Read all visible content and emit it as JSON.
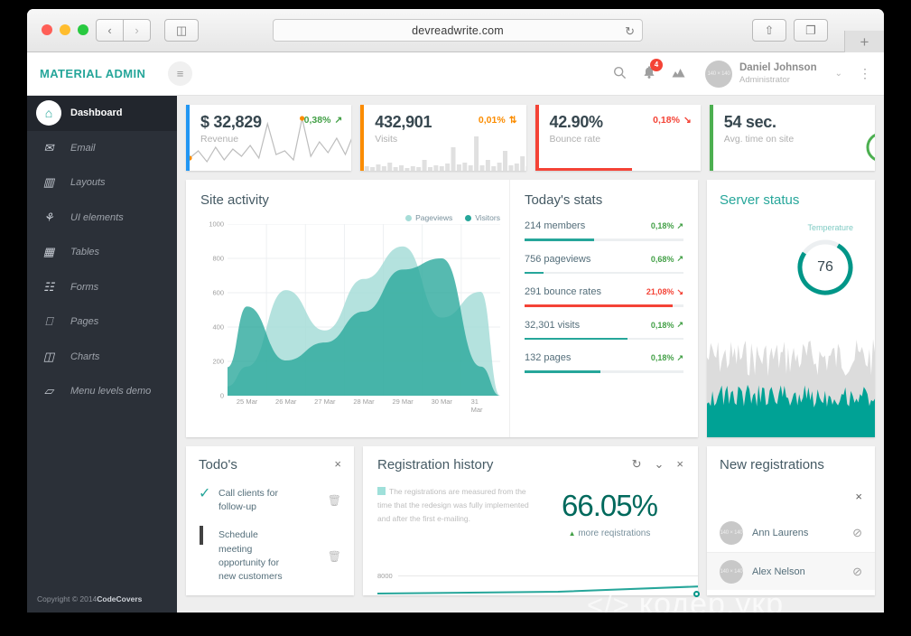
{
  "browser": {
    "url": "devreadwrite.com",
    "back_icon": "‹",
    "forward_icon": "›",
    "sidebar_icon": "◫",
    "reload_icon": "↻",
    "share_icon": "⇧",
    "tabs_icon": "❐",
    "new_tab_icon": "+"
  },
  "header": {
    "brand": "MATERIAL ADMIN",
    "hamburger_icon": "≡",
    "search_icon": "⚲",
    "bell_icon": " ὑ4",
    "notification_count": "4",
    "chart_icon": "◢",
    "avatar_text": "140 × 140",
    "user_name": "Daniel Johnson",
    "user_role": "Administrator",
    "caret_icon": "⌄",
    "more_icon": "⋮"
  },
  "sidebar": {
    "items": [
      {
        "label": "Dashboard",
        "icon": "⌂",
        "active": true
      },
      {
        "label": "Email",
        "icon": "✉",
        "active": false
      },
      {
        "label": "Layouts",
        "icon": "▥",
        "active": false
      },
      {
        "label": "UI elements",
        "icon": "⚘",
        "active": false
      },
      {
        "label": "Tables",
        "icon": "▦",
        "active": false
      },
      {
        "label": "Forms",
        "icon": "☷",
        "active": false
      },
      {
        "label": "Pages",
        "icon": "⎕",
        "active": false
      },
      {
        "label": "Charts",
        "icon": "◫",
        "active": false
      },
      {
        "label": "Menu levels demo",
        "icon": "▱",
        "active": false
      }
    ],
    "copyright_prefix": "Copyright © 2014 ",
    "copyright_brand": "CodeCovers"
  },
  "stat_cards": [
    {
      "value": "$ 32,829",
      "label": "Revenue",
      "delta": "0,38%",
      "delta_icon": "↗",
      "delta_color": "#43a047",
      "accent": "#2196f3",
      "spark": "line"
    },
    {
      "value": "432,901",
      "label": "Visits",
      "delta": "0,01%",
      "delta_icon": "⇅",
      "delta_color": "#fb8c00",
      "accent": "#fb8c00",
      "spark": "bars"
    },
    {
      "value": "42.90%",
      "label": "Bounce rate",
      "delta": "0,18%",
      "delta_icon": "↘",
      "delta_color": "#f44336",
      "accent": "#f44336",
      "spark": "none",
      "bar_percent": 58
    },
    {
      "value": "54 sec.",
      "label": "Avg. time on site",
      "delta": "",
      "delta_icon": "",
      "delta_color": "#43a047",
      "accent": "#4caf50",
      "spark": "timer"
    }
  ],
  "site_activity": {
    "title": "Site activity",
    "legend": [
      {
        "label": "Pageviews",
        "color": "#a7ddd8"
      },
      {
        "label": "Visitors",
        "color": "#26a69a"
      }
    ]
  },
  "chart_data": {
    "type": "area",
    "title": "Site activity",
    "xlabel": "",
    "ylabel": "",
    "ylim": [
      0,
      1000
    ],
    "yticks": [
      0,
      200,
      400,
      600,
      800,
      1000
    ],
    "categories": [
      "25 Mar",
      "26 Mar",
      "27 Mar",
      "28 Mar",
      "29 Mar",
      "30 Mar",
      "31 Mar"
    ],
    "grid": true,
    "legend_position": "top-right",
    "series": [
      {
        "name": "Pageviews",
        "color": "#a7ddd8",
        "values": [
          170,
          615,
          380,
          680,
          870,
          455,
          605
        ]
      },
      {
        "name": "Visitors",
        "color": "#26a69a",
        "values": [
          520,
          205,
          310,
          490,
          735,
          800,
          170
        ]
      }
    ]
  },
  "todays_stats": {
    "title": "Today's stats",
    "rows": [
      {
        "label": "214 members",
        "delta": "0,18%",
        "delta_icon": "↗",
        "delta_color": "#43a047",
        "fill_color": "#26a69a",
        "percent": 44
      },
      {
        "label": "756 pageviews",
        "delta": "0,68%",
        "delta_icon": "↗",
        "delta_color": "#43a047",
        "fill_color": "#26a69a",
        "percent": 12
      },
      {
        "label": "291 bounce rates",
        "delta": "21,08%",
        "delta_icon": "↘",
        "delta_color": "#f44336",
        "fill_color": "#f44336",
        "percent": 93
      },
      {
        "label": "32,301 visits",
        "delta": "0,18%",
        "delta_icon": "↗",
        "delta_color": "#43a047",
        "fill_color": "#26a69a",
        "percent": 65
      },
      {
        "label": "132 pages",
        "delta": "0,18%",
        "delta_icon": "↗",
        "delta_color": "#43a047",
        "fill_color": "#26a69a",
        "percent": 48
      }
    ]
  },
  "server_status": {
    "title": "Server status",
    "temperature_label": "Temperature",
    "temperature_value": "76"
  },
  "todos": {
    "title": "Todo's",
    "close_icon": "×",
    "items": [
      {
        "state": "done",
        "check_icon": "✓",
        "text": "Call clients for follow-up",
        "muted": false,
        "delete_icon": "🗑"
      },
      {
        "state": "open",
        "check_icon": "",
        "text": "Schedule meeting opportunity for new customers",
        "muted": false,
        "delete_icon": "🗑"
      }
    ]
  },
  "registration_history": {
    "title": "Registration history",
    "refresh_icon": "↻",
    "collapse_icon": "⌄",
    "close_icon": "×",
    "description": "The registrations are measured from the time that the redesign was fully implemented and after the first e-mailing.",
    "percent": "66.05%",
    "sub_icon": "▲",
    "sub_label": "more reqistrations",
    "axis_label": "8000"
  },
  "new_registrations": {
    "title": "New registrations",
    "close_icon": "×",
    "avatar_text": "140 × 140",
    "block_icon": "⊘",
    "items": [
      {
        "name": "Ann Laurens"
      },
      {
        "name": "Alex Nelson"
      }
    ]
  },
  "watermark": {
    "glyph": "</>",
    "text": "кодер.укр"
  }
}
